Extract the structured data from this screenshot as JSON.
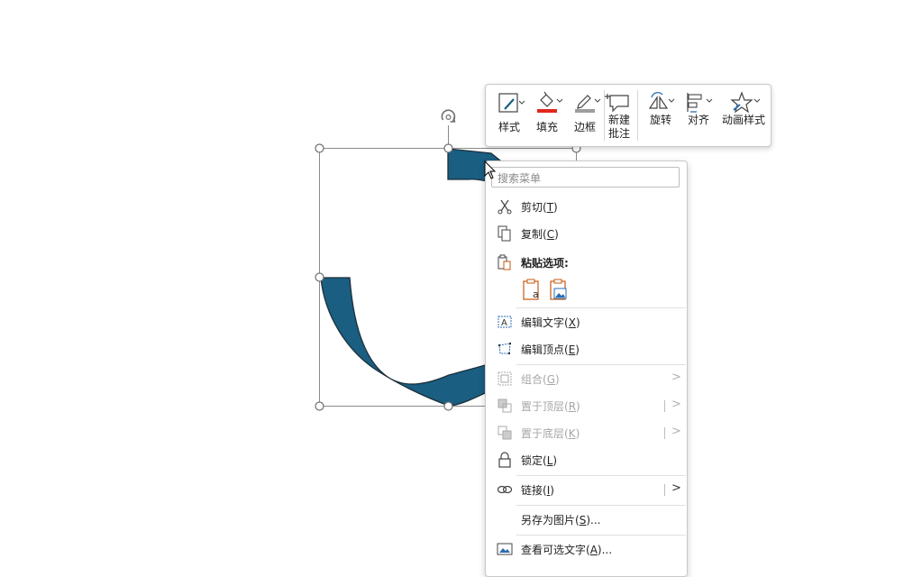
{
  "mini_toolbar": {
    "buttons": [
      {
        "label": "样式",
        "icon": "shape-style-icon"
      },
      {
        "label": "填充",
        "icon": "fill-bucket-icon"
      },
      {
        "label": "边框",
        "icon": "outline-pen-icon"
      },
      {
        "label_line1": "新建",
        "label_line2": "批注",
        "icon": "new-comment-icon"
      },
      {
        "label": "旋转",
        "icon": "rotate-icon"
      },
      {
        "label": "对齐",
        "icon": "align-icon"
      },
      {
        "label": "动画样式",
        "icon": "animation-star-icon"
      }
    ],
    "fill_color": "#e0281b",
    "outline_color": "#9e9e9e"
  },
  "context_menu": {
    "search_placeholder": "搜索菜单",
    "items": {
      "cut": {
        "label": "剪切",
        "key": "T"
      },
      "copy": {
        "label": "复制",
        "key": "C"
      },
      "paste_options": {
        "label": "粘贴选项:"
      },
      "edit_text": {
        "label": "编辑文字",
        "key": "X"
      },
      "edit_points": {
        "label": "编辑顶点",
        "key": "E"
      },
      "group": {
        "label": "组合",
        "key": "G"
      },
      "bring_to_front": {
        "label": "置于顶层",
        "key": "R"
      },
      "send_to_back": {
        "label": "置于底层",
        "key": "K"
      },
      "lock": {
        "label": "锁定",
        "key": "L"
      },
      "link": {
        "label": "链接",
        "key": "I"
      },
      "save_as_picture": {
        "label": "另存为图片",
        "key": "S",
        "suffix": "..."
      },
      "alt_text": {
        "label": "查看可选文字",
        "key": "A",
        "suffix": "..."
      }
    },
    "submenu_arrow": ">"
  },
  "shape": {
    "fill_color": "#1a5e82",
    "stroke_color": "#1c2f3a"
  }
}
